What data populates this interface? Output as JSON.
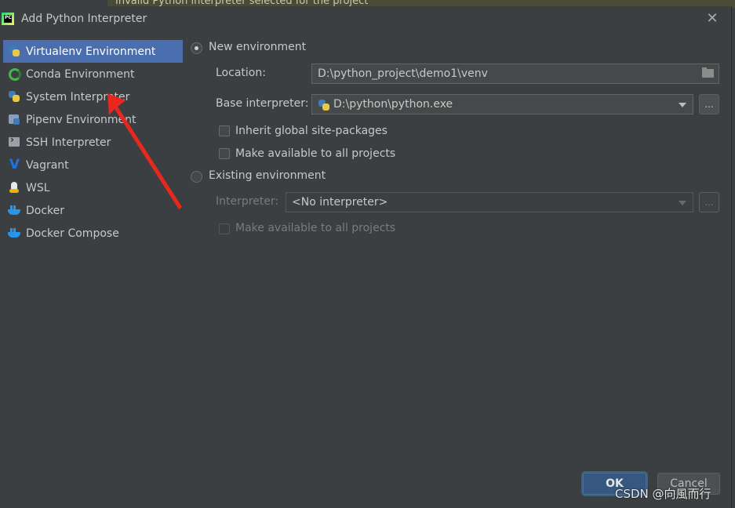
{
  "background_banner": "Invalid Python interpreter selected for the project",
  "dialog": {
    "title": "Add Python Interpreter",
    "close_symbol": "✕"
  },
  "sidebar": {
    "items": [
      {
        "label": "Virtualenv Environment",
        "icon": "python-icon",
        "selected": true
      },
      {
        "label": "Conda Environment",
        "icon": "conda-icon"
      },
      {
        "label": "System Interpreter",
        "icon": "python-icon"
      },
      {
        "label": "Pipenv Environment",
        "icon": "pipenv-icon"
      },
      {
        "label": "SSH Interpreter",
        "icon": "ssh-icon"
      },
      {
        "label": "Vagrant",
        "icon": "vagrant-icon"
      },
      {
        "label": "WSL",
        "icon": "linux-icon"
      },
      {
        "label": "Docker",
        "icon": "docker-icon"
      },
      {
        "label": "Docker Compose",
        "icon": "docker-icon"
      }
    ]
  },
  "new_env": {
    "radio_label": "New environment",
    "location_label": "Location:",
    "location_value": "D:\\python_project\\demo1\\venv",
    "base_label": "Base interpreter:",
    "base_value": "D:\\python\\python.exe",
    "inherit_label": "Inherit global site-packages",
    "make_available_label": "Make available to all projects",
    "browse_label": "..."
  },
  "existing_env": {
    "radio_label": "Existing environment",
    "interpreter_label": "Interpreter:",
    "interpreter_value": "<No interpreter>",
    "make_available_label": "Make available to all projects",
    "browse_label": "..."
  },
  "buttons": {
    "ok": "OK",
    "cancel": "Cancel"
  },
  "watermark": "CSDN @向風而行",
  "colors": {
    "accent_selected": "#4b6eaf",
    "annotation_arrow": "#e8281f"
  }
}
